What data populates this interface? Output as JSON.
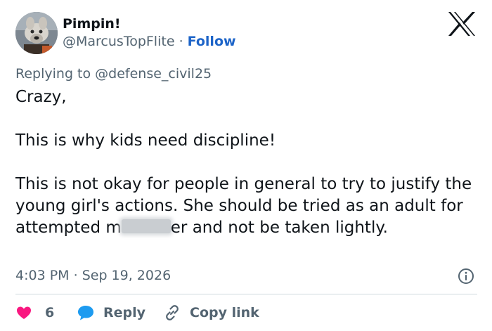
{
  "author": {
    "name": "Pimpin!",
    "handle": "@MarcusTopFlite",
    "separator": "·",
    "follow_label": "Follow"
  },
  "replying": {
    "prefix": "Replying to",
    "mention": "@defense_civil25"
  },
  "tweet": {
    "line1": "Crazy,",
    "line2": "This is why kids need discipline!",
    "line3_before_redaction": "This is not okay for people in general to try to justify the young girl's actions. She should be tried as an adult for attempted m",
    "line3_after_redaction": "er and not be taken lightly."
  },
  "meta": {
    "time": "4:03 PM",
    "separator": "·",
    "date": "Sep 19, 2026"
  },
  "actions": {
    "like_count": "6",
    "reply_label": "Reply",
    "copy_link_label": "Copy link"
  },
  "colors": {
    "like": "#f91880",
    "reply": "#1d9bf0",
    "follow": "#1d64c8",
    "muted": "#536471",
    "text": "#0f1419"
  },
  "icons": [
    "x-logo-icon",
    "info-icon",
    "heart-icon",
    "reply-bubble-icon",
    "link-icon"
  ]
}
